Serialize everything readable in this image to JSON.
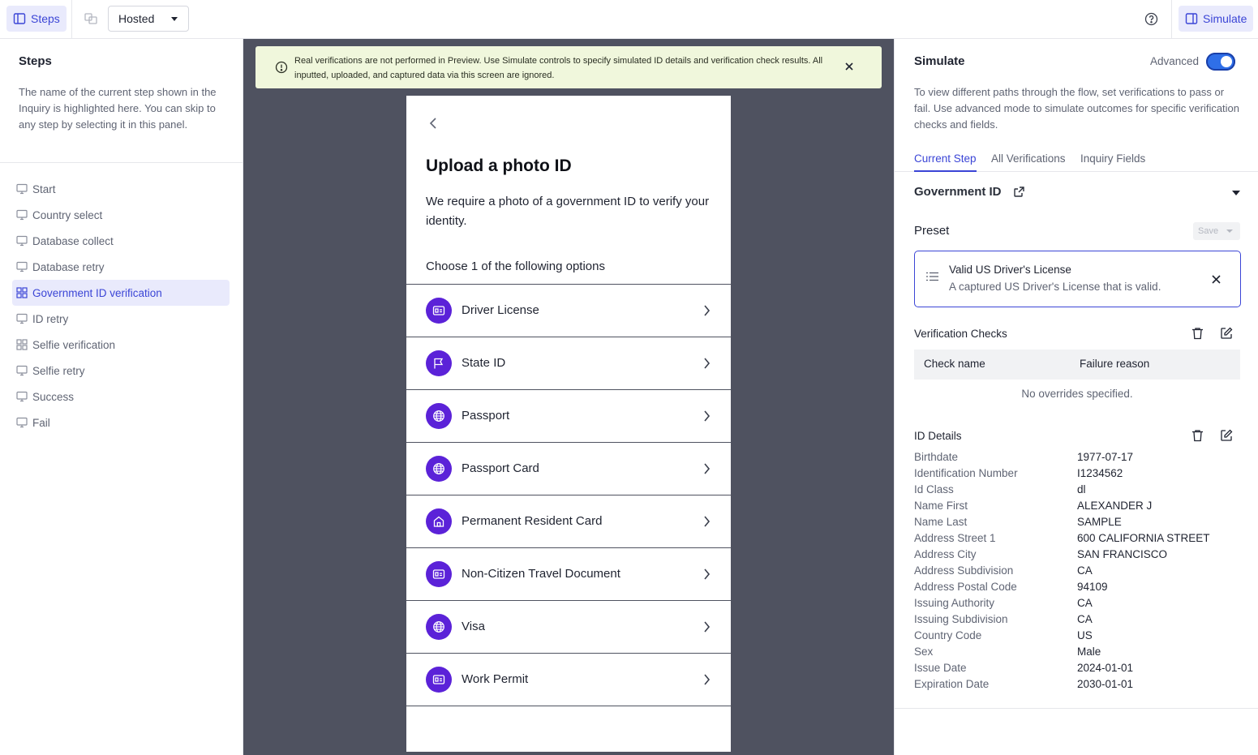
{
  "topbar": {
    "steps_label": "Steps",
    "mode_select": "Hosted",
    "simulate_label": "Simulate"
  },
  "left": {
    "title": "Steps",
    "description": "The name of the current step shown in the Inquiry is highlighted here. You can skip to any step by selecting it in this panel.",
    "steps": [
      {
        "label": "Start",
        "icon": "monitor-icon"
      },
      {
        "label": "Country select",
        "icon": "monitor-icon"
      },
      {
        "label": "Database collect",
        "icon": "monitor-icon"
      },
      {
        "label": "Database retry",
        "icon": "monitor-icon"
      },
      {
        "label": "Government ID verification",
        "icon": "grid-icon",
        "active": true
      },
      {
        "label": "ID retry",
        "icon": "monitor-icon"
      },
      {
        "label": "Selfie verification",
        "icon": "grid-icon"
      },
      {
        "label": "Selfie retry",
        "icon": "monitor-icon"
      },
      {
        "label": "Success",
        "icon": "monitor-icon"
      },
      {
        "label": "Fail",
        "icon": "monitor-icon"
      }
    ]
  },
  "banner": {
    "text": "Real verifications are not performed in Preview. Use Simulate controls to specify simulated ID details and verification check results. All inputted, uploaded, and captured data via this screen are ignored."
  },
  "phone": {
    "title": "Upload a photo ID",
    "subtitle": "We require a photo of a government ID to verify your identity.",
    "choose_label": "Choose 1 of the following options",
    "options": [
      {
        "label": "Driver License",
        "icon": "id-card-icon"
      },
      {
        "label": "State ID",
        "icon": "flag-icon"
      },
      {
        "label": "Passport",
        "icon": "globe-icon"
      },
      {
        "label": "Passport Card",
        "icon": "globe-icon"
      },
      {
        "label": "Permanent Resident Card",
        "icon": "home-icon"
      },
      {
        "label": "Non-Citizen Travel Document",
        "icon": "id-card-icon"
      },
      {
        "label": "Visa",
        "icon": "globe-icon"
      },
      {
        "label": "Work Permit",
        "icon": "id-card-icon"
      }
    ]
  },
  "right": {
    "title": "Simulate",
    "advanced_label": "Advanced",
    "advanced_on": true,
    "description": "To view different paths through the flow, set verifications to pass or fail. Use advanced mode to simulate outcomes for specific verification checks and fields.",
    "tabs": [
      "Current Step",
      "All Verifications",
      "Inquiry Fields"
    ],
    "section_title": "Government ID",
    "preset_label": "Preset",
    "save_label": "Save",
    "preset": {
      "name": "Valid US Driver's License",
      "description": "A captured US Driver's License that is valid."
    },
    "verification_checks_label": "Verification Checks",
    "checks_columns": [
      "Check name",
      "Failure reason"
    ],
    "checks_empty": "No overrides specified.",
    "id_details_label": "ID Details",
    "id_details": [
      {
        "key": "Birthdate",
        "value": "1977-07-17"
      },
      {
        "key": "Identification Number",
        "value": "I1234562"
      },
      {
        "key": "Id Class",
        "value": "dl"
      },
      {
        "key": "Name First",
        "value": "ALEXANDER J"
      },
      {
        "key": "Name Last",
        "value": "SAMPLE"
      },
      {
        "key": "Address Street 1",
        "value": "600 CALIFORNIA STREET"
      },
      {
        "key": "Address City",
        "value": "SAN FRANCISCO"
      },
      {
        "key": "Address Subdivision",
        "value": "CA"
      },
      {
        "key": "Address Postal Code",
        "value": "94109"
      },
      {
        "key": "Issuing Authority",
        "value": "CA"
      },
      {
        "key": "Issuing Subdivision",
        "value": "CA"
      },
      {
        "key": "Country Code",
        "value": "US"
      },
      {
        "key": "Sex",
        "value": "Male"
      },
      {
        "key": "Issue Date",
        "value": "2024-01-01"
      },
      {
        "key": "Expiration Date",
        "value": "2030-01-01"
      }
    ]
  },
  "colors": {
    "accent": "#3b45d6",
    "accent_bg": "#e9eafc",
    "option_icon_bg": "#5b22d8",
    "preview_bg": "#4f5260",
    "banner_bg": "#f0f7dc"
  }
}
